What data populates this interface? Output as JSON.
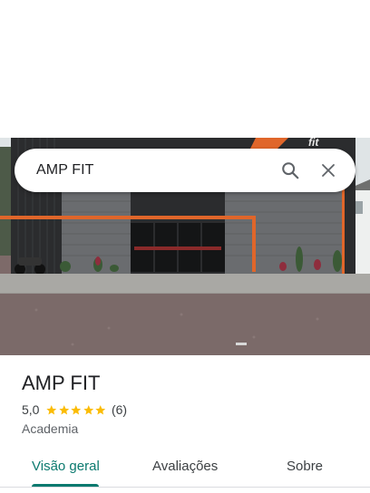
{
  "search": {
    "query": "AMP FIT",
    "search_icon": "search-icon",
    "close_icon": "close-icon"
  },
  "photo": {
    "sign_text": "fit"
  },
  "place": {
    "name": "AMP FIT",
    "rating_value": "5,0",
    "rating_stars": 5,
    "review_count": "(6)",
    "category": "Academia"
  },
  "tabs": [
    {
      "label": "Visão geral",
      "active": true
    },
    {
      "label": "Avaliações",
      "active": false
    },
    {
      "label": "Sobre",
      "active": false
    }
  ],
  "colors": {
    "accent": "#0b7a6f",
    "star": "#fbbc04",
    "brand_orange": "#e0662a"
  }
}
